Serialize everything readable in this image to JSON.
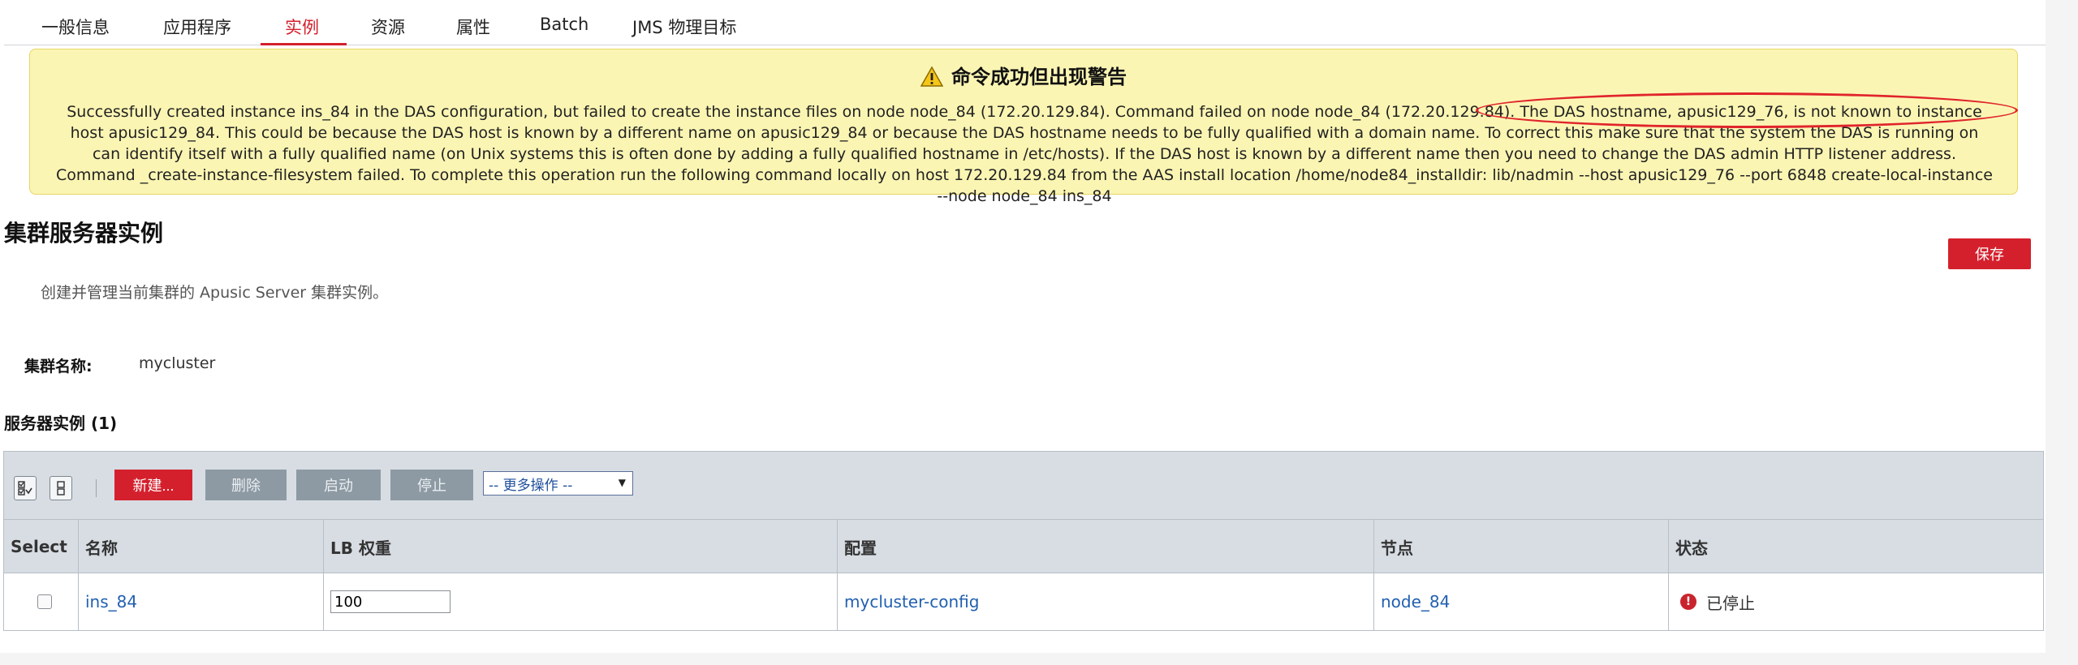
{
  "tabs": [
    {
      "label": "一般信息"
    },
    {
      "label": "应用程序"
    },
    {
      "label": "实例"
    },
    {
      "label": "资源"
    },
    {
      "label": "属性"
    },
    {
      "label": "Batch"
    },
    {
      "label": "JMS 物理目标"
    }
  ],
  "active_tab": "实例",
  "alert": {
    "title": "命令成功但出现警告",
    "message": "Successfully created instance ins_84 in the DAS configuration, but failed to create the instance files on node node_84 (172.20.129.84). Command failed on node node_84 (172.20.129.84). The DAS hostname, apusic129_76, is not known to instance host apusic129_84. This could be because the DAS host is known by a different name on apusic129_84 or because the DAS hostname needs to be fully qualified with a domain name. To correct this make sure that the system the DAS is running on can identify itself with a fully qualified name (on Unix systems this is often done by adding a fully qualified hostname in /etc/hosts). If the DAS host is known by a different name then you need to change the DAS admin HTTP listener address. Command _create-instance-filesystem failed. To complete this operation run the following command locally on host 172.20.129.84 from the AAS install location /home/node84_installdir: lib/nadmin --host apusic129_76 --port 6848 create-local-instance --node node_84 ins_84"
  },
  "page": {
    "title": "集群服务器实例",
    "save_label": "保存",
    "description": "创建并管理当前集群的 Apusic Server 集群实例。",
    "cluster_name_label": "集群名称:",
    "cluster_name_value": "mycluster",
    "section_title": "服务器实例 (1)"
  },
  "toolbar": {
    "new_label": "新建...",
    "delete_label": "删除",
    "start_label": "启动",
    "stop_label": "停止",
    "more_actions": "-- 更多操作 --"
  },
  "table": {
    "headers": [
      "Select",
      "名称",
      "LB 权重",
      "配置",
      "节点",
      "状态"
    ],
    "rows": [
      {
        "name": "ins_84",
        "lb_weight": "100",
        "config": "mycluster-config",
        "node": "node_84",
        "status": "已停止"
      }
    ]
  },
  "colors": {
    "accent": "#d4202d",
    "link": "#2160b0",
    "alert_bg": "#fbf5b3",
    "header_bg": "#d8dde4"
  },
  "icons": [
    "warning-icon",
    "select-all-icon",
    "deselect-all-icon",
    "error-status-icon",
    "dropdown-caret-icon"
  ]
}
